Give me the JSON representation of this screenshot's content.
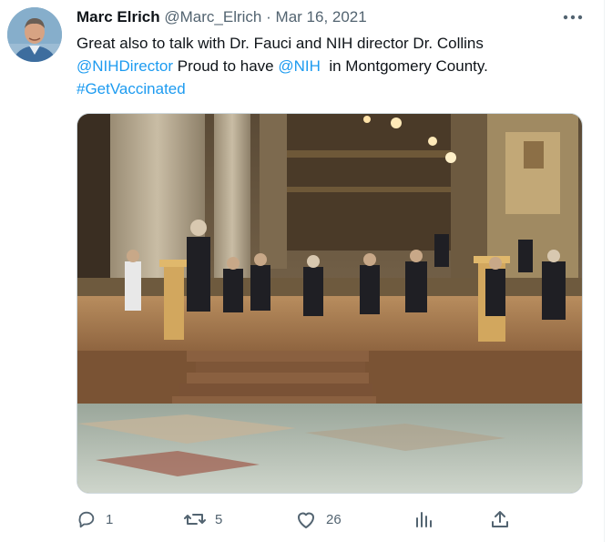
{
  "tweet": {
    "author": {
      "name": "Marc Elrich",
      "handle": "@Marc_Elrich"
    },
    "separator": "·",
    "date": "Mar 16, 2021",
    "text": {
      "line1": "Great also to talk with Dr. Fauci and NIH director Dr. Collins",
      "mention1": "@NIHDirector",
      "middle": " Proud to have ",
      "mention2": "@NIH",
      "tail": "  in Montgomery County.",
      "hashtag": "#GetVaccinated"
    },
    "icons": {
      "more": "more-icon",
      "reply": "reply-icon",
      "retweet": "retweet-icon",
      "like": "heart-icon",
      "views": "analytics-icon",
      "share": "share-icon"
    },
    "actions": {
      "replies": "1",
      "retweets": "5",
      "likes": "26"
    },
    "colors": {
      "link": "#1d9bf0",
      "secondary": "#536471",
      "text": "#0f1419"
    }
  }
}
